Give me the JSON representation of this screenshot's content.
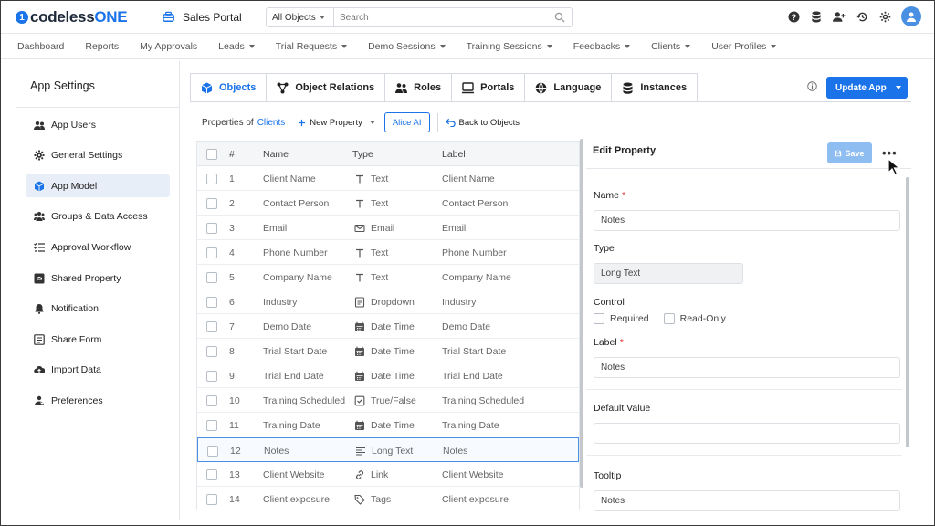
{
  "brand": {
    "logo_text": "codelessONE",
    "logo_prefix": "codeless",
    "logo_suffix": "ONE",
    "mark": "1"
  },
  "app": {
    "name": "Sales Portal"
  },
  "search": {
    "scope": "All Objects",
    "placeholder": "Search"
  },
  "nav": {
    "items": [
      {
        "label": "Dashboard",
        "dropdown": false
      },
      {
        "label": "Reports",
        "dropdown": false
      },
      {
        "label": "My Approvals",
        "dropdown": false
      },
      {
        "label": "Leads",
        "dropdown": true
      },
      {
        "label": "Trial Requests",
        "dropdown": true
      },
      {
        "label": "Demo Sessions",
        "dropdown": true
      },
      {
        "label": "Training Sessions",
        "dropdown": true
      },
      {
        "label": "Feedbacks",
        "dropdown": true
      },
      {
        "label": "Clients",
        "dropdown": true
      },
      {
        "label": "User Profiles",
        "dropdown": true
      }
    ]
  },
  "sidebar": {
    "title": "App Settings",
    "items": [
      {
        "label": "App Users",
        "icon": "users-icon"
      },
      {
        "label": "General Settings",
        "icon": "gear-icon"
      },
      {
        "label": "App Model",
        "icon": "cube-icon",
        "active": true
      },
      {
        "label": "Groups & Data Access",
        "icon": "group-icon"
      },
      {
        "label": "Approval Workflow",
        "icon": "checklist-icon"
      },
      {
        "label": "Shared Property",
        "icon": "shared-box-icon"
      },
      {
        "label": "Notification",
        "icon": "bell-icon"
      },
      {
        "label": "Share Form",
        "icon": "form-icon"
      },
      {
        "label": "Import Data",
        "icon": "cloud-upload-icon"
      },
      {
        "label": "Preferences",
        "icon": "preferences-icon"
      }
    ]
  },
  "tabs": [
    {
      "label": "Objects",
      "icon": "cube-icon",
      "active": true
    },
    {
      "label": "Object Relations",
      "icon": "relations-icon"
    },
    {
      "label": "Roles",
      "icon": "roles-icon"
    },
    {
      "label": "Portals",
      "icon": "portal-icon"
    },
    {
      "label": "Language",
      "icon": "globe-icon"
    },
    {
      "label": "Instances",
      "icon": "database-icon"
    }
  ],
  "update_button": {
    "label": "Update App"
  },
  "toolbar": {
    "properties_of_label": "Properties of",
    "object_name": "Clients",
    "new_property": "New Property",
    "alice_ai": "Alice AI",
    "back_to_objects": "Back to Objects"
  },
  "table": {
    "headers": [
      "#",
      "Name",
      "Type",
      "Label"
    ],
    "rows": [
      {
        "num": "1",
        "name": "Client Name",
        "type": "Text",
        "icon": "text-type-icon",
        "label": "Client Name"
      },
      {
        "num": "2",
        "name": "Contact Person",
        "type": "Text",
        "icon": "text-type-icon",
        "label": "Contact Person"
      },
      {
        "num": "3",
        "name": "Email",
        "type": "Email",
        "icon": "email-type-icon",
        "label": "Email"
      },
      {
        "num": "4",
        "name": "Phone Number",
        "type": "Text",
        "icon": "text-type-icon",
        "label": "Phone Number"
      },
      {
        "num": "5",
        "name": "Company Name",
        "type": "Text",
        "icon": "text-type-icon",
        "label": "Company Name"
      },
      {
        "num": "6",
        "name": "Industry",
        "type": "Dropdown",
        "icon": "dropdown-type-icon",
        "label": "Industry"
      },
      {
        "num": "7",
        "name": "Demo Date",
        "type": "Date Time",
        "icon": "calendar-type-icon",
        "label": "Demo Date"
      },
      {
        "num": "8",
        "name": "Trial Start Date",
        "type": "Date Time",
        "icon": "calendar-type-icon",
        "label": "Trial Start Date"
      },
      {
        "num": "9",
        "name": "Trial End Date",
        "type": "Date Time",
        "icon": "calendar-type-icon",
        "label": "Trial End Date"
      },
      {
        "num": "10",
        "name": "Training Scheduled",
        "type": "True/False",
        "icon": "checkbox-type-icon",
        "label": "Training Scheduled"
      },
      {
        "num": "11",
        "name": "Training Date",
        "type": "Date Time",
        "icon": "calendar-type-icon",
        "label": "Training Date"
      },
      {
        "num": "12",
        "name": "Notes",
        "type": "Long Text",
        "icon": "longtext-type-icon",
        "label": "Notes",
        "selected": true
      },
      {
        "num": "13",
        "name": "Client Website",
        "type": "Link",
        "icon": "link-type-icon",
        "label": "Client Website"
      },
      {
        "num": "14",
        "name": "Client exposure",
        "type": "Tags",
        "icon": "tag-type-icon",
        "label": "Client exposure"
      }
    ]
  },
  "edit_panel": {
    "title": "Edit Property",
    "save": "Save",
    "more": "•••",
    "name_label": "Name",
    "name_value": "Notes",
    "type_label": "Type",
    "type_value": "Long Text",
    "control_label": "Control",
    "required_label": "Required",
    "readonly_label": "Read-Only",
    "label_label": "Label",
    "label_value": "Notes",
    "default_label": "Default Value",
    "default_value": "",
    "tooltip_label": "Tooltip",
    "tooltip_value": "Notes",
    "required_marker": "*"
  },
  "colors": {
    "accent": "#1a73e8",
    "save_disabled": "#8ebdf2",
    "active_side": "#e8eef7"
  }
}
